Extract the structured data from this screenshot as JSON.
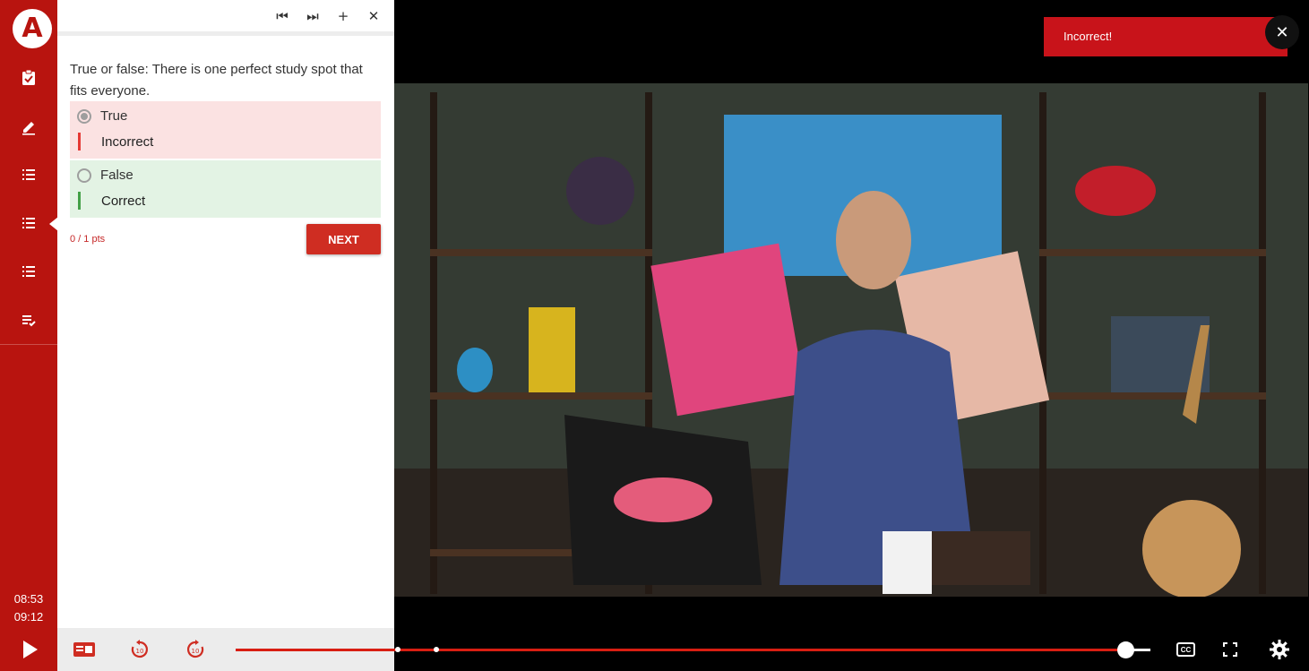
{
  "rail": {
    "logo_letter": "A",
    "nav": [
      {
        "name": "assignment-icon"
      },
      {
        "name": "pencil-icon"
      },
      {
        "name": "list-icon"
      },
      {
        "name": "list-icon-active",
        "active": true
      },
      {
        "name": "list-icon"
      },
      {
        "name": "playlist-check-icon"
      }
    ],
    "time_elapsed": "08:53",
    "time_total": "09:12"
  },
  "panel": {
    "toolbar": {
      "first": "⏮",
      "last": "⏭",
      "add": "+",
      "close": "✕"
    },
    "question": "True or false: There is one perfect study spot that fits everyone.",
    "options": [
      {
        "label": "True",
        "selected": true,
        "feedback": "Incorrect",
        "status": "incorrect"
      },
      {
        "label": "False",
        "selected": false,
        "feedback": "Correct",
        "status": "correct"
      }
    ],
    "points": "0 / 1 pts",
    "next_label": "NEXT"
  },
  "toast": {
    "message": "Incorrect!",
    "close": "✕"
  },
  "video": {
    "progress_fraction": 0.97,
    "volume_fraction": 0.0
  },
  "controls": {
    "cc_label": "CC"
  },
  "colors": {
    "brand_red": "#b8140f",
    "incorrect_bg": "#fbe2e2",
    "correct_bg": "#e3f3e4",
    "incorrect_bar": "#e53935",
    "correct_bar": "#43a047",
    "toast_red": "#c8131a"
  }
}
